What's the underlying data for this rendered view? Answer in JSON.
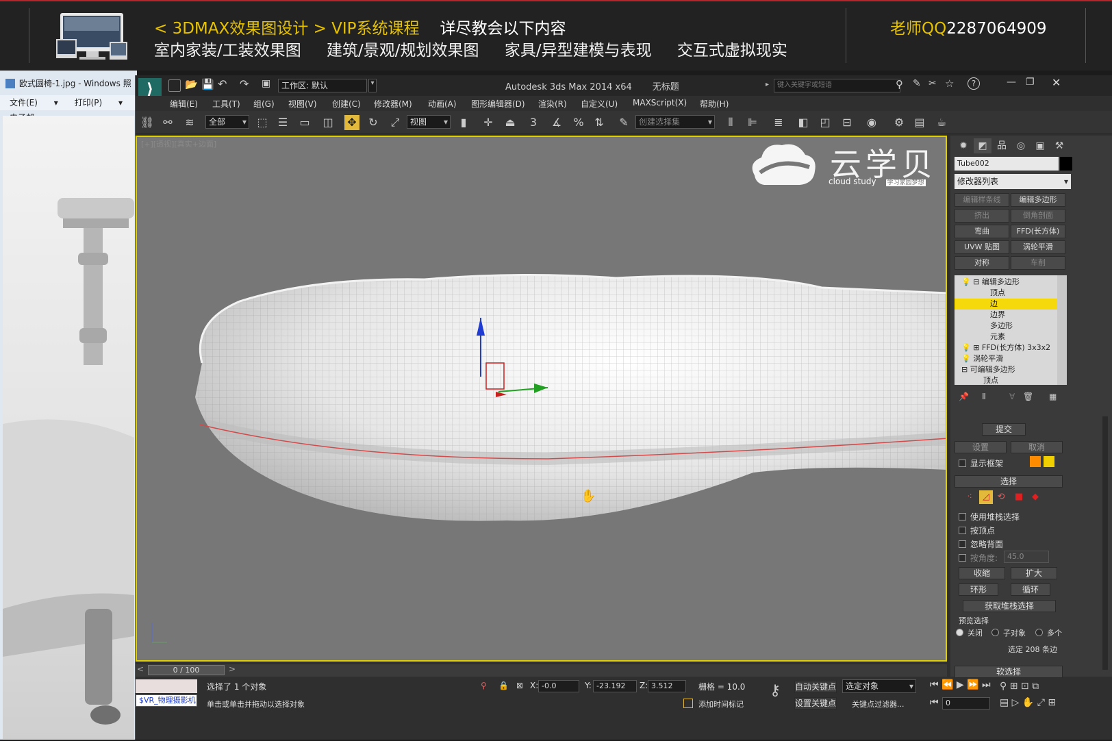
{
  "banner": {
    "line1_yellow": "< 3DMAX效果图设计 > VIP系统课程",
    "line1_white": "详尽教会以下内容",
    "line2": "室内家装/工装效果图 建筑/景观/规划效果图 家具/异型建模与表现 交互式虚拟现实",
    "qq_label": "老师QQ",
    "qq_number": "2287064909"
  },
  "bg_window": {
    "title": "欧式圆椅-1.jpg - Windows 照",
    "menu": "文件(E) ▾ 打印(P) ▾ 电子邮"
  },
  "max": {
    "app_title": "Autodesk 3ds Max  2014 x64",
    "doc_title": "无标题",
    "workspace": "工作区: 默认",
    "search_placeholder": "键入关键字或短语",
    "menu": [
      "编辑(E)",
      "工具(T)",
      "组(G)",
      "视图(V)",
      "创建(C)",
      "修改器(M)",
      "动画(A)",
      "图形编辑器(D)",
      "渲染(R)",
      "自定义(U)",
      "MAXScript(X)",
      "帮助(H)"
    ],
    "toolbar": {
      "filter": "全部",
      "refcoord": "视图",
      "named_selection": "创建选择集"
    },
    "viewport": {
      "label": "[+][透视][真实+边面]",
      "logo_cn": "云学贝",
      "logo_en": "cloud study",
      "logo_tag": "学习家园梦想"
    },
    "command_panel": {
      "object_name": "Tube002",
      "object_color": "#000000",
      "modifier_list": "修改器列表",
      "buttons": [
        {
          "label": "编辑样条线",
          "disabled": true
        },
        {
          "label": "编辑多边形",
          "disabled": false
        },
        {
          "label": "挤出",
          "disabled": true
        },
        {
          "label": "倒角剖面",
          "disabled": true
        },
        {
          "label": "弯曲",
          "disabled": false
        },
        {
          "label": "FFD(长方体)",
          "disabled": false
        },
        {
          "label": "UVW 贴图",
          "disabled": false
        },
        {
          "label": "涡轮平滑",
          "disabled": false
        },
        {
          "label": "对称",
          "disabled": false
        },
        {
          "label": "车削",
          "disabled": true
        }
      ],
      "stack": [
        {
          "label": "⊟ 编辑多边形",
          "indent": 1,
          "selected": false
        },
        {
          "label": "顶点",
          "indent": 3,
          "selected": false
        },
        {
          "label": "边",
          "indent": 3,
          "selected": true
        },
        {
          "label": "边界",
          "indent": 3,
          "selected": false
        },
        {
          "label": "多边形",
          "indent": 3,
          "selected": false
        },
        {
          "label": "元素",
          "indent": 3,
          "selected": false
        },
        {
          "label": "⊞ FFD(长方体) 3x3x2",
          "indent": 1,
          "selected": false
        },
        {
          "label": "涡轮平滑",
          "indent": 1,
          "selected": false
        },
        {
          "label": "⊟ 可编辑多边形",
          "indent": 0,
          "selected": false
        },
        {
          "label": "顶点",
          "indent": 2,
          "selected": false
        }
      ],
      "commit": "提交",
      "settings": "设置",
      "cancel": "取消",
      "show_cage": "显示框架",
      "cage_colors": [
        "#ff8c00",
        "#f0d000"
      ],
      "selection_header": "选择",
      "use_stack": "使用堆栈选择",
      "by_vertex": "按顶点",
      "ignore_backface": "忽略背面",
      "by_angle": "按角度:",
      "angle_value": "45.0",
      "shrink": "收缩",
      "grow": "扩大",
      "ring": "环形",
      "loop": "循环",
      "get_stack": "获取堆栈选择",
      "preview_label": "预览选择",
      "preview_options": [
        "关闭",
        "子对象",
        "多个"
      ],
      "selected_count": "选定 208 条边",
      "soft_selection": "软选择"
    },
    "time_slider": "0 / 100",
    "status": {
      "script_listener": "$VR_物理摄影机",
      "selected_msg": "选择了 1 个对象",
      "prompt": "单击或单击并拖动以选择对象",
      "x": "-0.0",
      "y": "-23.192",
      "z": "3.512",
      "grid": "栅格 = 10.0",
      "add_time_tag": "添加时间标记",
      "auto_key": "自动关键点",
      "set_key": "设置关键点",
      "key_mode": "选定对象",
      "key_filters": "关键点过滤器...",
      "frame": "0"
    }
  }
}
